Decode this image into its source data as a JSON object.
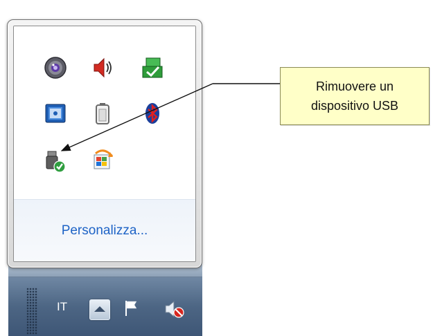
{
  "taskbar": {
    "language": "IT",
    "show_hidden_icons": "chevron-up-icon",
    "flag_icon": "action-center-flag-icon",
    "volume_icon": "volume-muted-icon"
  },
  "popup": {
    "icons": [
      {
        "name": "webcam-icon"
      },
      {
        "name": "volume-icon"
      },
      {
        "name": "network-check-icon"
      },
      {
        "name": "blue-app-icon"
      },
      {
        "name": "battery-icon"
      },
      {
        "name": "bluetooth-icon"
      },
      {
        "name": "usb-safely-remove-icon"
      },
      {
        "name": "windows-update-icon"
      }
    ],
    "customize_link": "Personalizza..."
  },
  "callout": {
    "line1": "Rimuovere un",
    "line2": "dispositivo USB"
  },
  "colors": {
    "link": "#1e63c6",
    "callout_bg": "#ffffc8",
    "taskbar": "#4d6684"
  }
}
